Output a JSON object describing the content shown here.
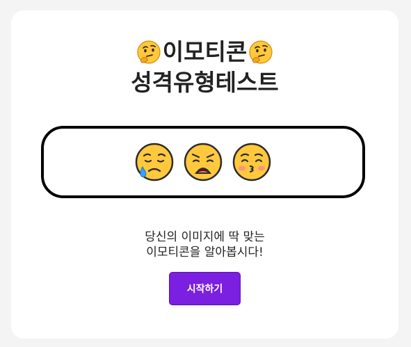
{
  "title": {
    "line1": "이모티콘",
    "line2": "성격유형테스트",
    "side_icon": "thinking-face-icon"
  },
  "preview": {
    "emojis": [
      {
        "icon": "sad-but-relieved-face-icon"
      },
      {
        "icon": "weary-face-icon"
      },
      {
        "icon": "kissing-face-closed-eyes-icon"
      }
    ]
  },
  "description": {
    "line1": "당신의 이미지에 딱 맞는",
    "line2": "이모티콘을 알아봅시다!"
  },
  "start_button": {
    "label": "시작하기"
  },
  "colors": {
    "accent": "#7b1fe0",
    "background": "#f4f4f4",
    "card": "#ffffff",
    "text": "#222222"
  }
}
